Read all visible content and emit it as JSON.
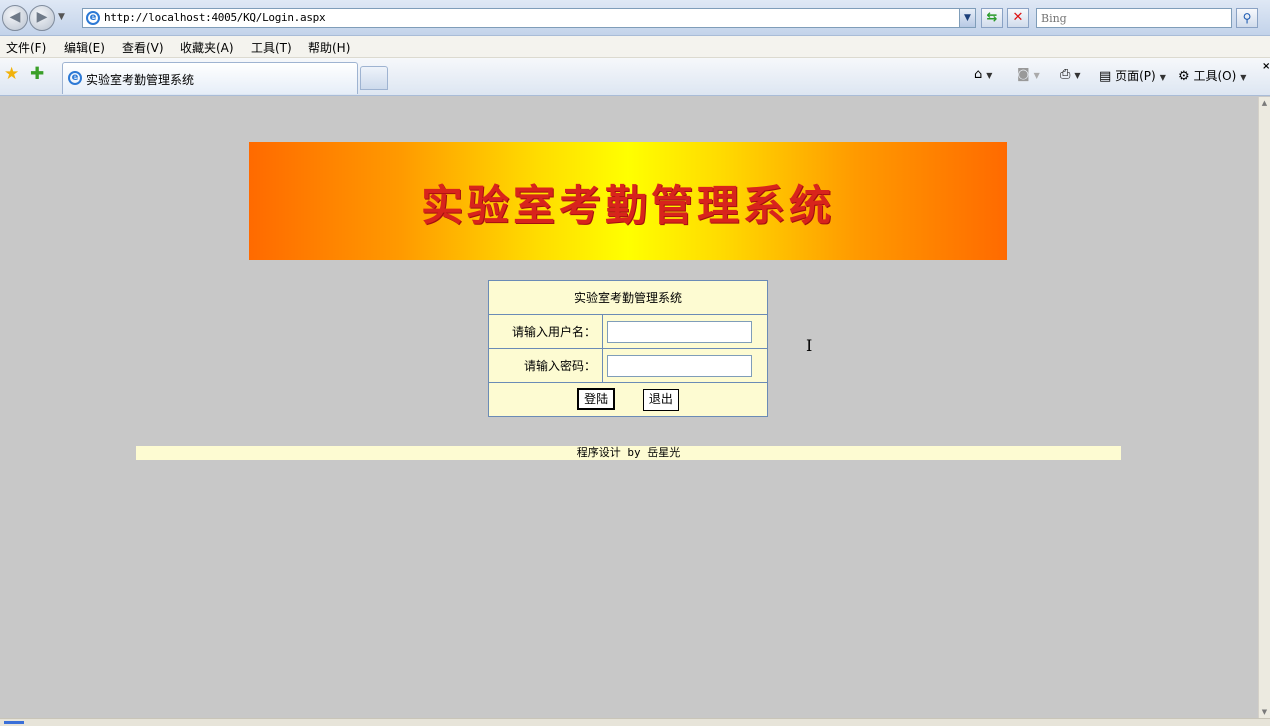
{
  "browser": {
    "url": "http://localhost:4005/KQ/Login.aspx",
    "search_placeholder": "Bing",
    "menu": [
      "文件(F)",
      "编辑(E)",
      "查看(V)",
      "收藏夹(A)",
      "工具(T)",
      "帮助(H)"
    ],
    "tab_title": "实验室考勤管理系统",
    "cmd_page": "页面(P)",
    "cmd_tools": "工具(O)"
  },
  "page": {
    "banner_title": "实验室考勤管理系统",
    "login": {
      "title": "实验室考勤管理系统",
      "username_label": "请输入用户名：",
      "username_value": "",
      "password_label": "请输入密码：",
      "password_value": "",
      "login_button": "登陆",
      "exit_button": "退出"
    },
    "footer": "程序设计 by 岳星光"
  },
  "icons": [
    "back-icon",
    "forward-icon",
    "ie-icon",
    "refresh-icon",
    "stop-icon",
    "search-icon",
    "favorites-star-icon",
    "add-favorite-icon",
    "home-icon",
    "rss-icon",
    "print-icon",
    "page-icon",
    "gear-icon",
    "close-icon",
    "text-cursor-icon"
  ],
  "colors": {
    "page_background": "#c8c8c8",
    "login_panel": "#fdfbd2",
    "panel_border": "#6b8bb6",
    "banner_text": "#d8241c",
    "banner_orange": "#ff6a00",
    "banner_yellow": "#ffff00"
  }
}
